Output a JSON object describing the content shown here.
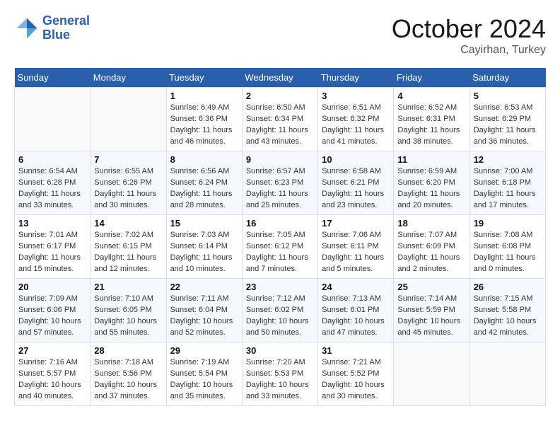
{
  "header": {
    "logo_line1": "General",
    "logo_line2": "Blue",
    "month": "October 2024",
    "location": "Cayirhan, Turkey"
  },
  "weekdays": [
    "Sunday",
    "Monday",
    "Tuesday",
    "Wednesday",
    "Thursday",
    "Friday",
    "Saturday"
  ],
  "weeks": [
    [
      {
        "day": "",
        "info": ""
      },
      {
        "day": "",
        "info": ""
      },
      {
        "day": "1",
        "info": "Sunrise: 6:49 AM\nSunset: 6:36 PM\nDaylight: 11 hours and 46 minutes."
      },
      {
        "day": "2",
        "info": "Sunrise: 6:50 AM\nSunset: 6:34 PM\nDaylight: 11 hours and 43 minutes."
      },
      {
        "day": "3",
        "info": "Sunrise: 6:51 AM\nSunset: 6:32 PM\nDaylight: 11 hours and 41 minutes."
      },
      {
        "day": "4",
        "info": "Sunrise: 6:52 AM\nSunset: 6:31 PM\nDaylight: 11 hours and 38 minutes."
      },
      {
        "day": "5",
        "info": "Sunrise: 6:53 AM\nSunset: 6:29 PM\nDaylight: 11 hours and 36 minutes."
      }
    ],
    [
      {
        "day": "6",
        "info": "Sunrise: 6:54 AM\nSunset: 6:28 PM\nDaylight: 11 hours and 33 minutes."
      },
      {
        "day": "7",
        "info": "Sunrise: 6:55 AM\nSunset: 6:26 PM\nDaylight: 11 hours and 30 minutes."
      },
      {
        "day": "8",
        "info": "Sunrise: 6:56 AM\nSunset: 6:24 PM\nDaylight: 11 hours and 28 minutes."
      },
      {
        "day": "9",
        "info": "Sunrise: 6:57 AM\nSunset: 6:23 PM\nDaylight: 11 hours and 25 minutes."
      },
      {
        "day": "10",
        "info": "Sunrise: 6:58 AM\nSunset: 6:21 PM\nDaylight: 11 hours and 23 minutes."
      },
      {
        "day": "11",
        "info": "Sunrise: 6:59 AM\nSunset: 6:20 PM\nDaylight: 11 hours and 20 minutes."
      },
      {
        "day": "12",
        "info": "Sunrise: 7:00 AM\nSunset: 6:18 PM\nDaylight: 11 hours and 17 minutes."
      }
    ],
    [
      {
        "day": "13",
        "info": "Sunrise: 7:01 AM\nSunset: 6:17 PM\nDaylight: 11 hours and 15 minutes."
      },
      {
        "day": "14",
        "info": "Sunrise: 7:02 AM\nSunset: 6:15 PM\nDaylight: 11 hours and 12 minutes."
      },
      {
        "day": "15",
        "info": "Sunrise: 7:03 AM\nSunset: 6:14 PM\nDaylight: 11 hours and 10 minutes."
      },
      {
        "day": "16",
        "info": "Sunrise: 7:05 AM\nSunset: 6:12 PM\nDaylight: 11 hours and 7 minutes."
      },
      {
        "day": "17",
        "info": "Sunrise: 7:06 AM\nSunset: 6:11 PM\nDaylight: 11 hours and 5 minutes."
      },
      {
        "day": "18",
        "info": "Sunrise: 7:07 AM\nSunset: 6:09 PM\nDaylight: 11 hours and 2 minutes."
      },
      {
        "day": "19",
        "info": "Sunrise: 7:08 AM\nSunset: 6:08 PM\nDaylight: 11 hours and 0 minutes."
      }
    ],
    [
      {
        "day": "20",
        "info": "Sunrise: 7:09 AM\nSunset: 6:06 PM\nDaylight: 10 hours and 57 minutes."
      },
      {
        "day": "21",
        "info": "Sunrise: 7:10 AM\nSunset: 6:05 PM\nDaylight: 10 hours and 55 minutes."
      },
      {
        "day": "22",
        "info": "Sunrise: 7:11 AM\nSunset: 6:04 PM\nDaylight: 10 hours and 52 minutes."
      },
      {
        "day": "23",
        "info": "Sunrise: 7:12 AM\nSunset: 6:02 PM\nDaylight: 10 hours and 50 minutes."
      },
      {
        "day": "24",
        "info": "Sunrise: 7:13 AM\nSunset: 6:01 PM\nDaylight: 10 hours and 47 minutes."
      },
      {
        "day": "25",
        "info": "Sunrise: 7:14 AM\nSunset: 5:59 PM\nDaylight: 10 hours and 45 minutes."
      },
      {
        "day": "26",
        "info": "Sunrise: 7:15 AM\nSunset: 5:58 PM\nDaylight: 10 hours and 42 minutes."
      }
    ],
    [
      {
        "day": "27",
        "info": "Sunrise: 7:16 AM\nSunset: 5:57 PM\nDaylight: 10 hours and 40 minutes."
      },
      {
        "day": "28",
        "info": "Sunrise: 7:18 AM\nSunset: 5:56 PM\nDaylight: 10 hours and 37 minutes."
      },
      {
        "day": "29",
        "info": "Sunrise: 7:19 AM\nSunset: 5:54 PM\nDaylight: 10 hours and 35 minutes."
      },
      {
        "day": "30",
        "info": "Sunrise: 7:20 AM\nSunset: 5:53 PM\nDaylight: 10 hours and 33 minutes."
      },
      {
        "day": "31",
        "info": "Sunrise: 7:21 AM\nSunset: 5:52 PM\nDaylight: 10 hours and 30 minutes."
      },
      {
        "day": "",
        "info": ""
      },
      {
        "day": "",
        "info": ""
      }
    ]
  ]
}
